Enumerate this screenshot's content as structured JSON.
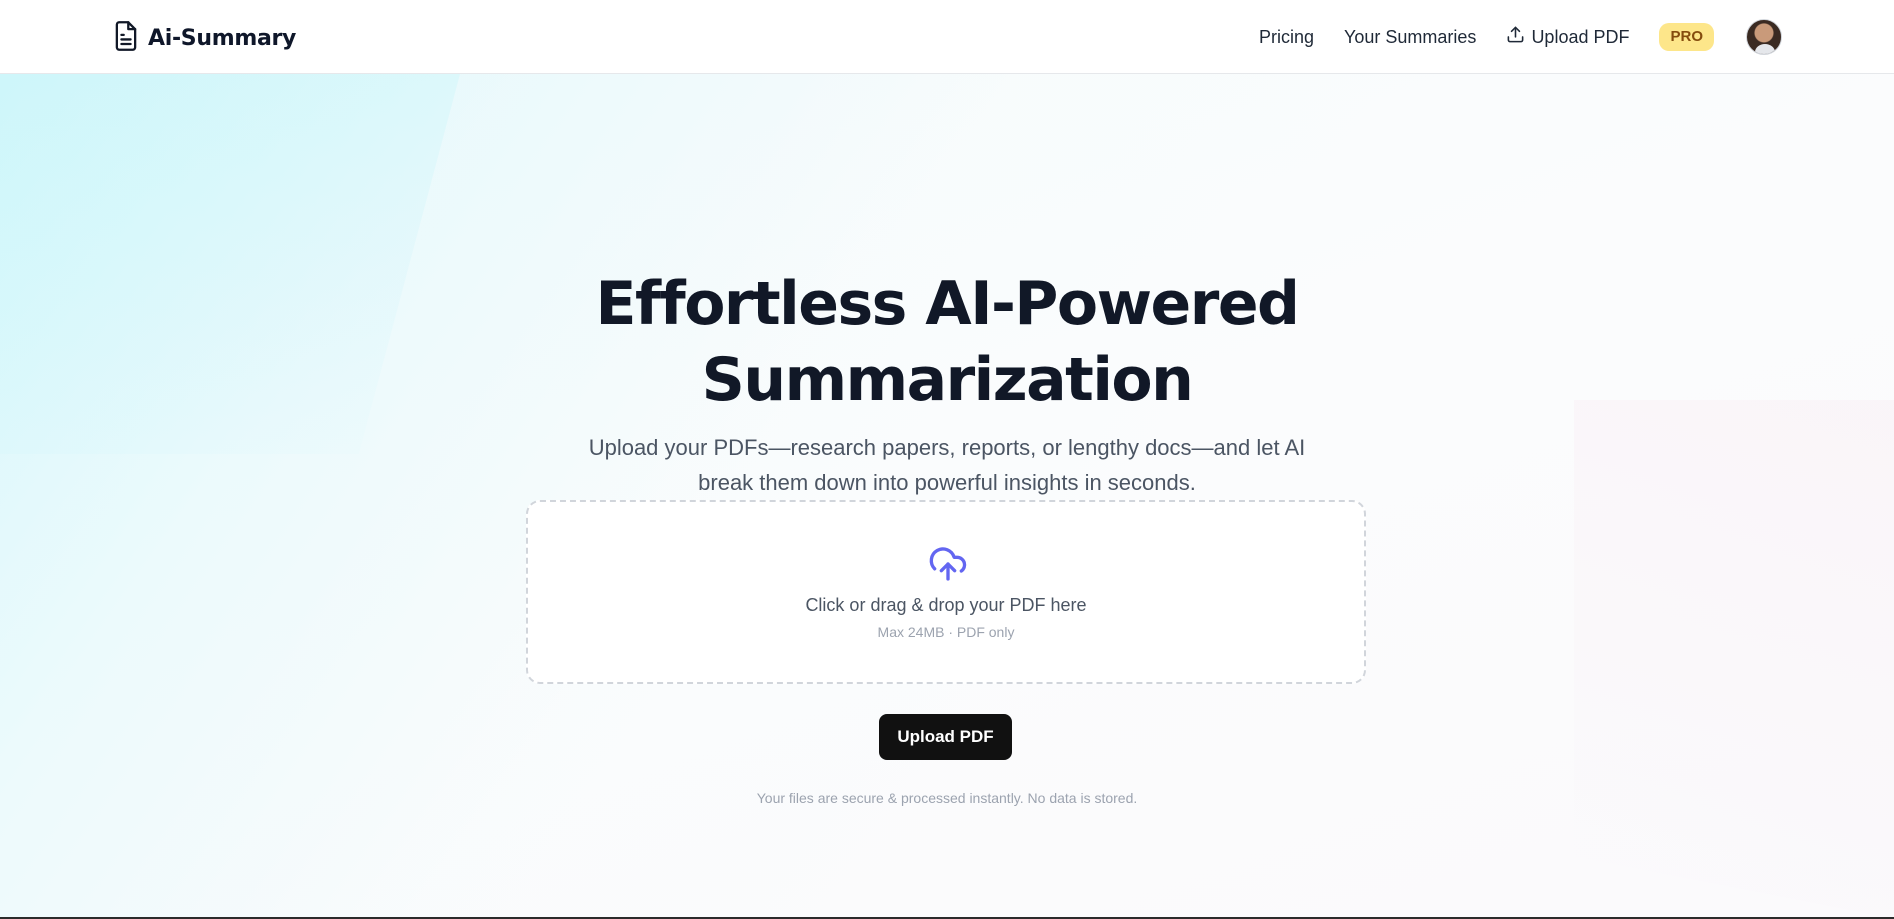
{
  "header": {
    "logo_icon": "document-icon",
    "brand": "Ai-Summary",
    "nav": {
      "pricing": "Pricing",
      "summaries": "Your Summaries",
      "upload": "Upload PDF",
      "upload_icon": "upload-icon",
      "pro_badge": "PRO"
    }
  },
  "hero": {
    "title_line1": "Effortless AI-Powered",
    "title_line2": "Summarization",
    "subtitle": "Upload your PDFs—research papers, reports, or lengthy docs—and let AI break them down into powerful insights in seconds."
  },
  "dropzone": {
    "icon": "cloud-upload-icon",
    "title": "Click or drag & drop your PDF here",
    "hint": "Max 24MB · PDF only"
  },
  "actions": {
    "upload_button": "Upload PDF"
  },
  "footer_note": "Your files are secure & processed instantly. No data is stored.",
  "colors": {
    "primary_text": "#111827",
    "accent_icon": "#6366f1",
    "button_bg": "#111111",
    "pro_badge_bg": "#fde68a"
  }
}
